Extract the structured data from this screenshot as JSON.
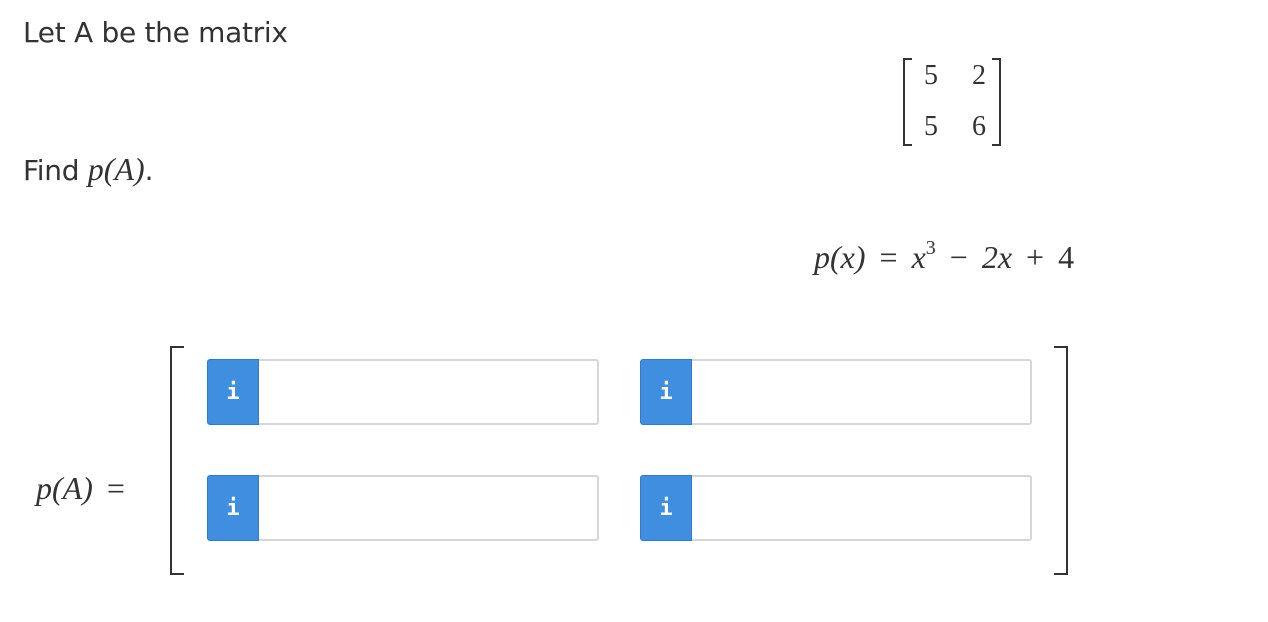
{
  "question": {
    "intro_text": "Let A be the matrix",
    "find_prefix": "Find",
    "find_math": "p(A)",
    "find_suffix": "."
  },
  "matrix_a": {
    "rows": [
      [
        "5",
        "2"
      ],
      [
        "5",
        "6"
      ]
    ]
  },
  "polynomial": {
    "lhs": "p(x)",
    "eq": "=",
    "base": "x",
    "exponent": "3",
    "minus": "−",
    "linear_term": "2x",
    "plus": "+",
    "constant": "4"
  },
  "answer": {
    "label": "p(A)",
    "eq": "=",
    "info_icon": "i",
    "cells": [
      {
        "value": "",
        "placeholder": ""
      },
      {
        "value": "",
        "placeholder": ""
      },
      {
        "value": "",
        "placeholder": ""
      },
      {
        "value": "",
        "placeholder": ""
      }
    ]
  },
  "colors": {
    "info_button": "#3f8ee0",
    "input_border": "#d6d6d6",
    "text": "#333333"
  }
}
